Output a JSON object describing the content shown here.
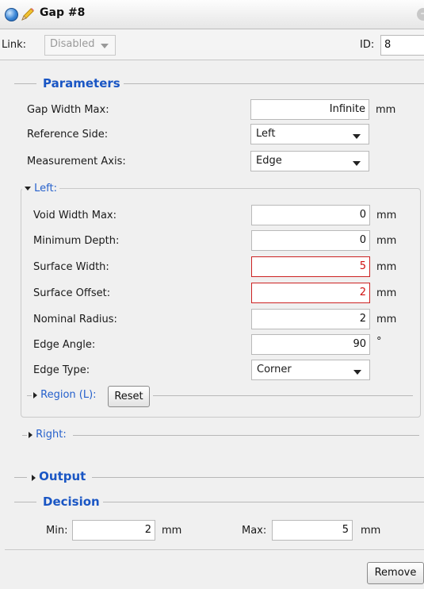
{
  "window": {
    "title": "Gap #8"
  },
  "link": {
    "label": "Link:",
    "value": "Disabled"
  },
  "id": {
    "label": "ID:",
    "value": "8"
  },
  "parameters": {
    "title": "Parameters",
    "gap_width_max": {
      "label": "Gap Width Max:",
      "value": "Infinite",
      "unit": "mm"
    },
    "reference_side": {
      "label": "Reference Side:",
      "value": "Left"
    },
    "measurement_axis": {
      "label": "Measurement Axis:",
      "value": "Edge"
    }
  },
  "left": {
    "title": "Left:",
    "void_width_max": {
      "label": "Void Width Max:",
      "value": "0",
      "unit": "mm"
    },
    "minimum_depth": {
      "label": "Minimum Depth:",
      "value": "0",
      "unit": "mm"
    },
    "surface_width": {
      "label": "Surface Width:",
      "value": "5",
      "unit": "mm"
    },
    "surface_offset": {
      "label": "Surface Offset:",
      "value": "2",
      "unit": "mm"
    },
    "nominal_radius": {
      "label": "Nominal Radius:",
      "value": "2",
      "unit": "mm"
    },
    "edge_angle": {
      "label": "Edge Angle:",
      "value": "90",
      "unit": "°"
    },
    "edge_type": {
      "label": "Edge Type:",
      "value": "Corner"
    },
    "region": {
      "label": "Region (L):",
      "reset_label": "Reset"
    }
  },
  "right": {
    "title": "Right:"
  },
  "output": {
    "title": "Output"
  },
  "decision": {
    "title": "Decision",
    "min": {
      "label": "Min:",
      "value": "2",
      "unit": "mm"
    },
    "max": {
      "label": "Max:",
      "value": "5",
      "unit": "mm"
    }
  },
  "footer": {
    "remove_label": "Remove"
  },
  "colors": {
    "accent": "#1a56c4",
    "error": "#cc2222"
  },
  "icons": [
    "window-orb-icon",
    "pencil-icon",
    "collapse-icon",
    "chevron-down-icon",
    "triangle-right-icon",
    "triangle-down-icon"
  ]
}
